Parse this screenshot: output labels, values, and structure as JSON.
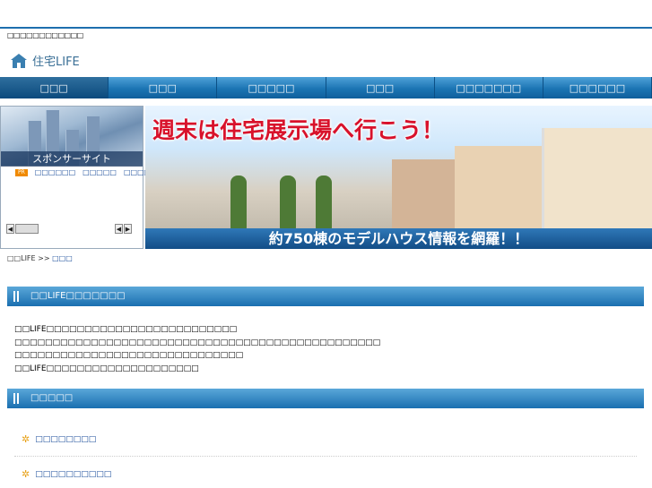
{
  "header": {
    "tiny_text": "□□□□□□□□□□□□",
    "logo_text": "住宅LIFE"
  },
  "nav": {
    "items": [
      {
        "label": "□□□",
        "active": true
      },
      {
        "label": "□□□",
        "active": false
      },
      {
        "label": "□□□□□",
        "active": false
      },
      {
        "label": "□□□",
        "active": false
      },
      {
        "label": "□□□□□□□",
        "active": false
      },
      {
        "label": "□□□□□□",
        "active": false
      }
    ]
  },
  "sponsor": {
    "title": "スポンサーサイト",
    "pr_badge": "PR",
    "links": [
      "□□□□□□",
      "□□□□□",
      "□□□□□□□"
    ]
  },
  "hero": {
    "headline": "週末は住宅展示場へ行こう！",
    "banner": "約750棟のモデルハウス情報を網羅！！"
  },
  "breadcrumb": {
    "root": "□□LIFE >>",
    "current": "□□□"
  },
  "section1": {
    "heading": "□□LIFE□□□□□□□",
    "lines": [
      "□□LIFE□□□□□□□□□□□□□□□□□□□□□□□□□",
      "□□□□□□□□□□□□□□□□□□□□□□□□□□□□□□□□□□□□□□□□□□□□□□□□",
      "□□□□□□□□□□□□□□□□□□□□□□□□□□□□□□",
      "□□LIFE□□□□□□□□□□□□□□□□□□□□"
    ]
  },
  "section2": {
    "heading": "□□□□□",
    "items": [
      "□□□□□□□□",
      "□□□□□□□□□□"
    ]
  },
  "colors": {
    "accent": "#1a6fb0",
    "link": "#1a4c9a",
    "headline_red": "#d8122b"
  }
}
